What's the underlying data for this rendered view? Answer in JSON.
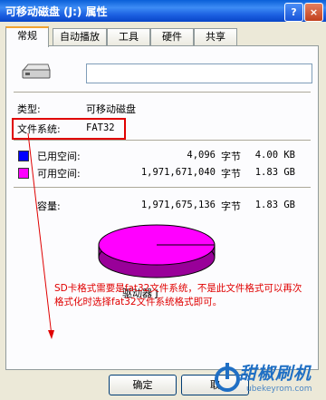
{
  "window": {
    "title": "可移动磁盘 (J:) 属性",
    "help_icon": "?",
    "close_icon": "×"
  },
  "tabs": [
    {
      "label": "常规",
      "active": true
    },
    {
      "label": "自动播放"
    },
    {
      "label": "工具"
    },
    {
      "label": "硬件"
    },
    {
      "label": "共享"
    }
  ],
  "general": {
    "name_value": "",
    "type_label": "类型:",
    "type_value": "可移动磁盘",
    "fs_label": "文件系统:",
    "fs_value": "FAT32",
    "used_label": "已用空间:",
    "used_bytes": "4,096",
    "used_unit": "字节",
    "used_size": "4.00 KB",
    "free_label": "可用空间:",
    "free_bytes": "1,971,671,040",
    "free_unit": "字节",
    "free_size": "1.83 GB",
    "capacity_label": "容量:",
    "capacity_bytes": "1,971,675,136",
    "capacity_unit": "字节",
    "capacity_size": "1.83 GB",
    "drive_label": "驱动器 J"
  },
  "colors": {
    "used": "#0000ff",
    "free": "#ff00ff",
    "annotation": "#e00000"
  },
  "annotation": "SD卡格式需要是fat32文件系统，不是此文件格式可以再次格式化时选择fat32文件系统格式即可。",
  "buttons": {
    "ok": "确定",
    "cancel": "取"
  },
  "watermark": {
    "text": "甜椒刷机",
    "url": "ubekeyrom.com"
  }
}
